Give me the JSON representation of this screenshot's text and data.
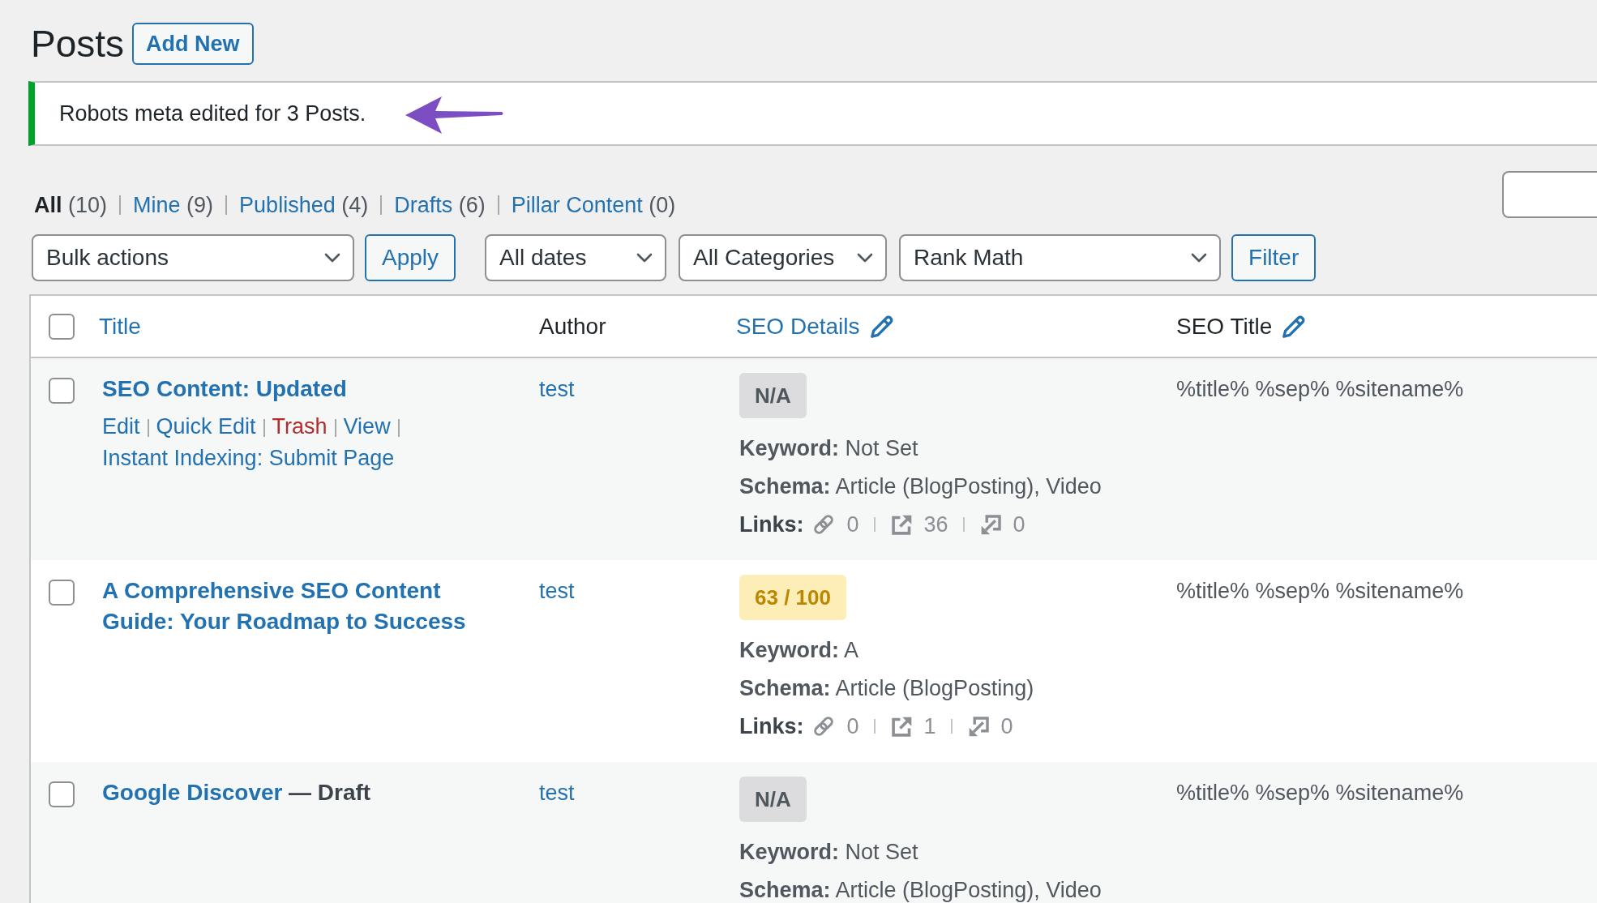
{
  "page": {
    "title": "Posts",
    "add_new_button": "Add New"
  },
  "notice": {
    "message": "Robots meta edited for 3 Posts.",
    "callout_arrow": true
  },
  "views": [
    {
      "label": "All",
      "count": "(10)",
      "selected": true
    },
    {
      "label": "Mine",
      "count": "(9)",
      "selected": false
    },
    {
      "label": "Published",
      "count": "(4)",
      "selected": false
    },
    {
      "label": "Drafts",
      "count": "(6)",
      "selected": false
    },
    {
      "label": "Pillar Content",
      "count": "(0)",
      "selected": false
    }
  ],
  "bulk_actions": {
    "select": "Bulk actions",
    "button": "Apply"
  },
  "filters": {
    "selects": [
      "All dates",
      "All Categories",
      "Rank Math"
    ],
    "button": "Filter"
  },
  "table": {
    "select_all": {
      "checked": false
    },
    "columns": [
      {
        "label": "Title",
        "sortable": true,
        "editable": false
      },
      {
        "label": "Author",
        "sortable": false,
        "editable": false
      },
      {
        "label": "SEO Details",
        "sortable": true,
        "editable": true
      },
      {
        "label": "SEO Title",
        "sortable": false,
        "editable": true
      }
    ],
    "rows": [
      {
        "checked": false,
        "title": "SEO Content: Updated",
        "row_actions": [
          {
            "label": "Edit",
            "kind": "link"
          },
          {
            "label": "Quick Edit",
            "kind": "link"
          },
          {
            "label": "Trash",
            "kind": "delete"
          },
          {
            "label": "View",
            "kind": "link"
          },
          {
            "label": "Instant Indexing: Submit Page",
            "kind": "link"
          }
        ],
        "author": "test",
        "seo_score": {
          "label": "N/A",
          "kind": "none"
        },
        "keyword": "**Keyword:** Not Set",
        "schema": "**Schema:** Article (BlogPosting), Video",
        "links": {
          "label": "Links:",
          "internal": "0",
          "external": "36",
          "incoming": "0"
        },
        "seo_title": "%title% %sep% %sitename%"
      },
      {
        "checked": false,
        "title": "A Comprehensive SEO Content Guide: Your Roadmap to Success",
        "author": "test",
        "seo_score": {
          "label": "63 / 100",
          "kind": "average"
        },
        "keyword": "**Keyword:** A",
        "schema": "**Schema:** Article (BlogPosting)",
        "links": {
          "label": "Links:",
          "internal": "0",
          "external": "1",
          "incoming": "0"
        },
        "seo_title": "%title% %sep% %sitename%"
      },
      {
        "checked": false,
        "title": "Google Discover",
        "post_state": "— Draft",
        "author": "test",
        "seo_score": {
          "label": "N/A",
          "kind": "none"
        },
        "keyword": "**Keyword:** Not Set",
        "schema": "**Schema:** Article (BlogPosting), Video",
        "seo_title": "%title% %sep% %sitename%"
      }
    ]
  }
}
